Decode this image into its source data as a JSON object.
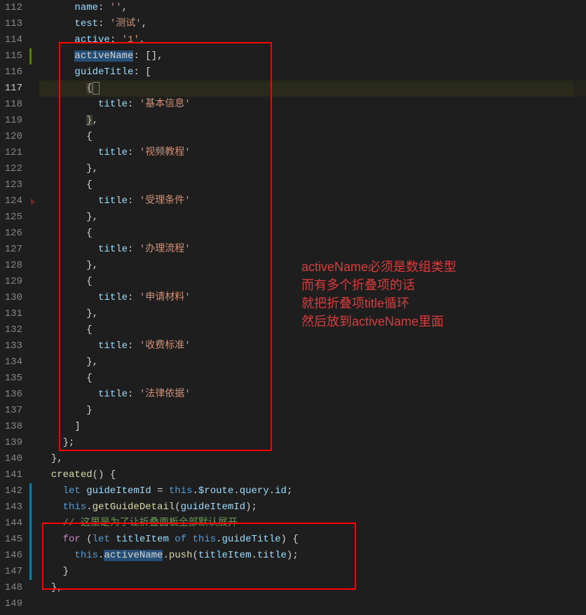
{
  "annotation": {
    "l1": "activeName必须是数组类型",
    "l2": "而有多个折叠项的话",
    "l3": "就把折叠项title循环",
    "l4": "然后放到activeName里面"
  },
  "code": {
    "l112": {
      "k": "name",
      "v": "''"
    },
    "l113": {
      "k": "test",
      "v": "'测试'"
    },
    "l114": {
      "k": "active",
      "v": "'1'"
    },
    "l115": {
      "k": "activeName",
      "v": "[]"
    },
    "l116": {
      "k": "guideTitle"
    },
    "l118": {
      "k": "title",
      "v": "'基本信息'"
    },
    "l121": {
      "k": "title",
      "v": "'视频教程'"
    },
    "l124": {
      "k": "title",
      "v": "'受理条件'"
    },
    "l127": {
      "k": "title",
      "v": "'办理流程'"
    },
    "l130": {
      "k": "title",
      "v": "'申请材料'"
    },
    "l133": {
      "k": "title",
      "v": "'收费标准'"
    },
    "l136": {
      "k": "title",
      "v": "'法律依据'"
    },
    "l141": {
      "fn": "created"
    },
    "l142": {
      "kw": "let",
      "var": "guideItemId",
      "this": "this",
      "route": "$route",
      "query": "query",
      "id": "id"
    },
    "l143": {
      "this": "this",
      "fn": "getGuideDetail",
      "arg": "guideItemId"
    },
    "l144": {
      "comment": "// 这里是为了让折叠面板全部默认展开"
    },
    "l145": {
      "for": "for",
      "let": "let",
      "item": "titleItem",
      "of": "of",
      "this": "this",
      "arr": "guideTitle"
    },
    "l146": {
      "this": "this",
      "active": "activeName",
      "push": "push",
      "arg1": "titleItem",
      "arg2": "title"
    }
  },
  "lineStart": 112,
  "lineEnd": 149
}
